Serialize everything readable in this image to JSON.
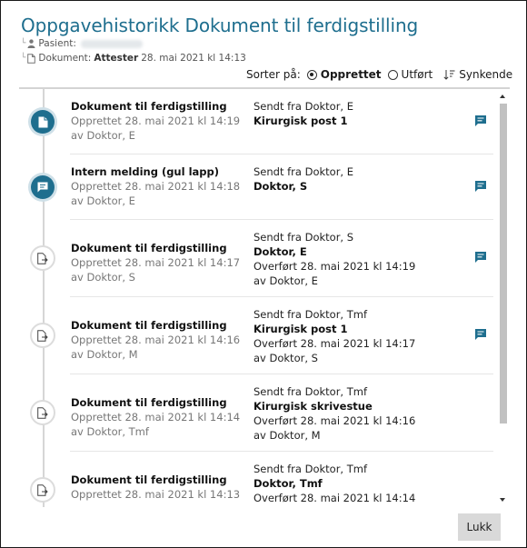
{
  "dialog": {
    "title": "Oppgavehistorikk Dokument til ferdigstilling",
    "patient_label": "Pasient:",
    "document_label": "Dokument:",
    "document_status": "Attester",
    "document_date": "28. mai 2021 kl 14:13"
  },
  "sort": {
    "label": "Sorter på:",
    "options": [
      {
        "label": "Opprettet",
        "selected": true
      },
      {
        "label": "Utført",
        "selected": false
      }
    ],
    "order_label": "Synkende"
  },
  "entries": [
    {
      "title": "Dokument til ferdigstilling",
      "created": "Opprettet 28. mai 2021 kl 14:19",
      "created_by": "av Doktor, E",
      "sent_from": "Sendt fra Doktor, E",
      "recipient": "Kirurgisk post 1",
      "transferred": "",
      "transferred_by": "",
      "icon": "document-icon",
      "active": true,
      "has_note": true
    },
    {
      "title": "Intern melding (gul lapp)",
      "created": "Opprettet 28. mai 2021 kl 14:18",
      "created_by": "av Doktor, E",
      "sent_from": "Sendt fra Doktor, E",
      "recipient": "Doktor, S",
      "transferred": "",
      "transferred_by": "",
      "icon": "message-icon",
      "active": true,
      "has_note": true
    },
    {
      "title": "Dokument til ferdigstilling",
      "created": "Opprettet 28. mai 2021 kl 14:17",
      "created_by": "av Doktor, S",
      "sent_from": "Sendt fra Doktor, S",
      "recipient": "Doktor, E",
      "transferred": "Overført 28. mai 2021 kl 14:19",
      "transferred_by": "av Doktor, E",
      "icon": "document-forward-icon",
      "active": false,
      "has_note": true
    },
    {
      "title": "Dokument til ferdigstilling",
      "created": "Opprettet 28. mai 2021 kl 14:16",
      "created_by": "av Doktor, M",
      "sent_from": "Sendt fra Doktor, Tmf",
      "recipient": "Kirurgisk post 1",
      "transferred": "Overført 28. mai 2021 kl 14:17",
      "transferred_by": "av Doktor, S",
      "icon": "document-forward-icon",
      "active": false,
      "has_note": true
    },
    {
      "title": "Dokument til ferdigstilling",
      "created": "Opprettet 28. mai 2021 kl 14:14",
      "created_by": "av Doktor, Tmf",
      "sent_from": "Sendt fra Doktor, Tmf",
      "recipient": "Kirurgisk skrivestue",
      "transferred": "Overført 28. mai 2021 kl 14:16",
      "transferred_by": "av Doktor, M",
      "icon": "document-forward-icon",
      "active": false,
      "has_note": false
    },
    {
      "title": "Dokument til ferdigstilling",
      "created": "Opprettet 28. mai 2021 kl 14:13",
      "created_by": "",
      "sent_from": "Sendt fra Doktor, Tmf",
      "recipient": "Doktor, Tmf",
      "transferred": "Overført 28. mai 2021 kl 14:14",
      "transferred_by": "",
      "icon": "document-forward-icon",
      "active": false,
      "has_note": false
    }
  ],
  "buttons": {
    "close_label": "Lukk"
  },
  "colors": {
    "accent": "#1e6e8e"
  }
}
